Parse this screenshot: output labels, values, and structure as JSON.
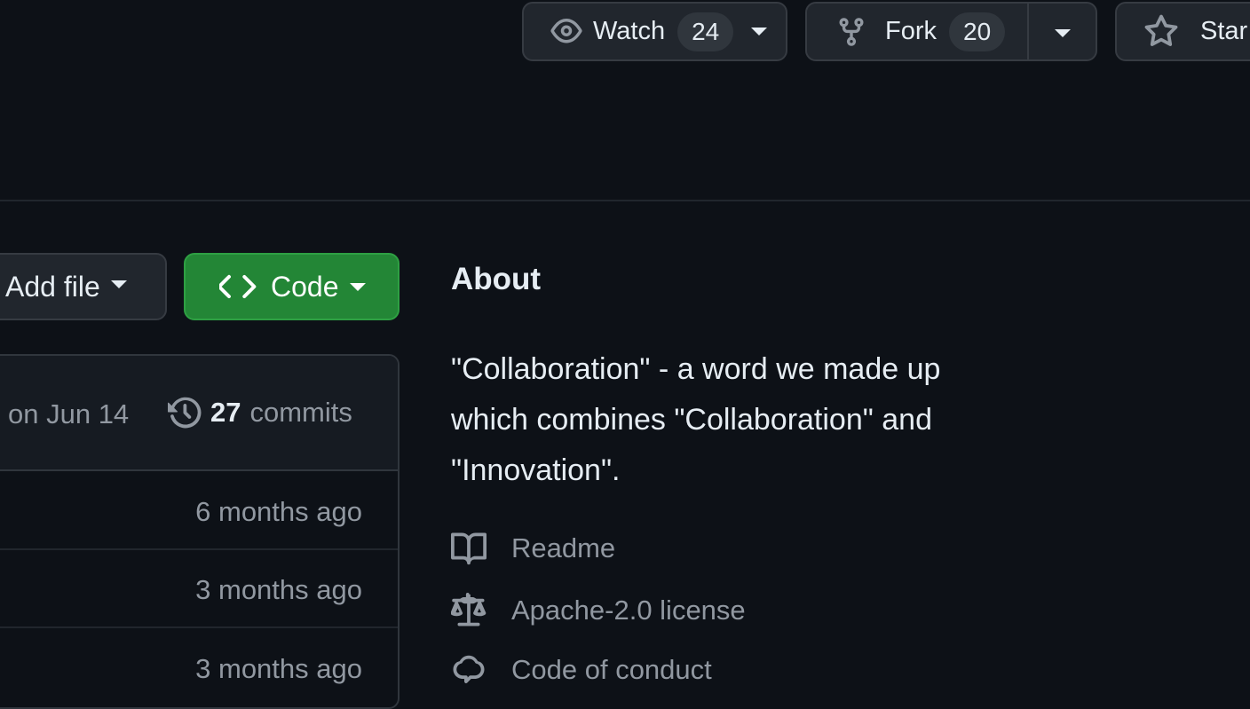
{
  "repo_actions": {
    "watch": {
      "label": "Watch",
      "count": "24"
    },
    "fork": {
      "label": "Fork",
      "count": "20"
    },
    "star": {
      "label": "Star"
    }
  },
  "toolbar": {
    "add_file_label": "Add file",
    "code_label": "Code"
  },
  "file_list": {
    "latest_commit_date": "on Jun 14",
    "commits_count": "27",
    "commits_label": "commits",
    "rows": [
      {
        "time": "6 months ago"
      },
      {
        "time": "3 months ago"
      },
      {
        "time": "3 months ago"
      }
    ]
  },
  "about": {
    "heading": "About",
    "description_lines": [
      "\"Collaboration\" - a word we made up",
      "which combines \"Collaboration\" and",
      "\"Innovation\"."
    ],
    "links": [
      {
        "label": "Readme",
        "icon": "book-icon"
      },
      {
        "label": "Apache-2.0 license",
        "icon": "law-icon"
      },
      {
        "label": "Code of conduct",
        "icon": "code-of-conduct-icon"
      }
    ]
  },
  "colors": {
    "background": "#0d1117",
    "button_bg": "#21262d",
    "primary_green": "#238636",
    "text": "#e6edf3",
    "muted": "#9198a1"
  }
}
